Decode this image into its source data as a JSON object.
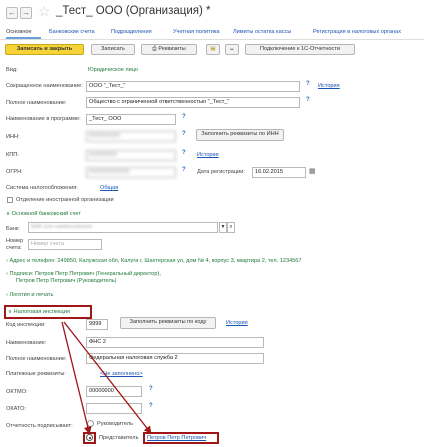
{
  "title": "_Тест_ ООО (Организация) *",
  "tabs": [
    "Основное",
    "Банковские счета",
    "Подразделения",
    "Учетная политика",
    "Лимиты остатка кассы",
    "Регистрация в налоговых органах"
  ],
  "toolbar": {
    "save_close": "Записать и закрыть",
    "save": "Записать",
    "requisites": "Реквизиты",
    "connect": "Подключение к 1С-Отчетности"
  },
  "form": {
    "type_label": "Вид:",
    "type_value": "Юридическое лицо",
    "short_name_label": "Сокращенное наименование:",
    "short_name_value": "ООО \"_Тест_\"",
    "history": "История",
    "full_name_label": "Полное наименование:",
    "full_name_value": "Общество с ограниченной ответственностью \"_Тест_\"",
    "prog_name_label": "Наименование в программе:",
    "prog_name_value": "_Тест_ ООО",
    "inn_label": "ИНН:",
    "inn_value": "0000000000",
    "fill_by_inn": "Заполнить реквизиты по ИНН",
    "kpp_label": "КПП:",
    "kpp_value": "000000000",
    "ogrn_label": "ОГРН:",
    "ogrn_value": "0000000000000",
    "reg_date_label": "Дата регистрации:",
    "reg_date_value": "16.02.2015",
    "tax_system_label": "Система налогообложения:",
    "tax_system_value": "Общая",
    "foreign_branch": "Отделение иностранной организации",
    "bank_section": "Основной банковский счет",
    "bank_label": "Банк:",
    "bank_placeholder": "БИК или наименование",
    "account_label": "Номер счета:",
    "account_placeholder": "Номер счета",
    "address": "Адрес и телефон: 249850, Калужская обл, Калуга г, Шахтерская ул, дом № 4, корпус 3, квартира 2, тел. 1234567",
    "signatures_line1": "Подписи: Петров Петр Петрович (Генеральный директор),",
    "signatures_line2": "Петров Петр Петрович (Руководитель)",
    "logo": "Логотип и печать",
    "tax_section": "Налоговая инспекция",
    "tax_code_label": "Код инспекции:",
    "tax_code_value": "9999",
    "fill_by_code": "Заполнить реквизиты по коду",
    "tax_history": "История",
    "tax_name_label": "Наименование:",
    "tax_name_value": "ФНС 2",
    "tax_full_label": "Полное наименование:",
    "tax_full_value": "Федеральная налоговая служба 2",
    "payment_label": "Платежные реквизиты:",
    "payment_value": "<Не заполнено>",
    "oktmo_label": "ОКТМО:",
    "oktmo_value": "00000000",
    "okato_label": "ОКАТО:",
    "signer_label": "Отчетность подписывает:",
    "signer_option1": "Руководитель",
    "signer_option2": "Представитель",
    "signer_person": "Петров Петр Петрович"
  },
  "colors": {
    "accent": "#f6d437",
    "highlight": "#a01515",
    "section": "#1f7a3a",
    "link": "#1a56b3"
  }
}
